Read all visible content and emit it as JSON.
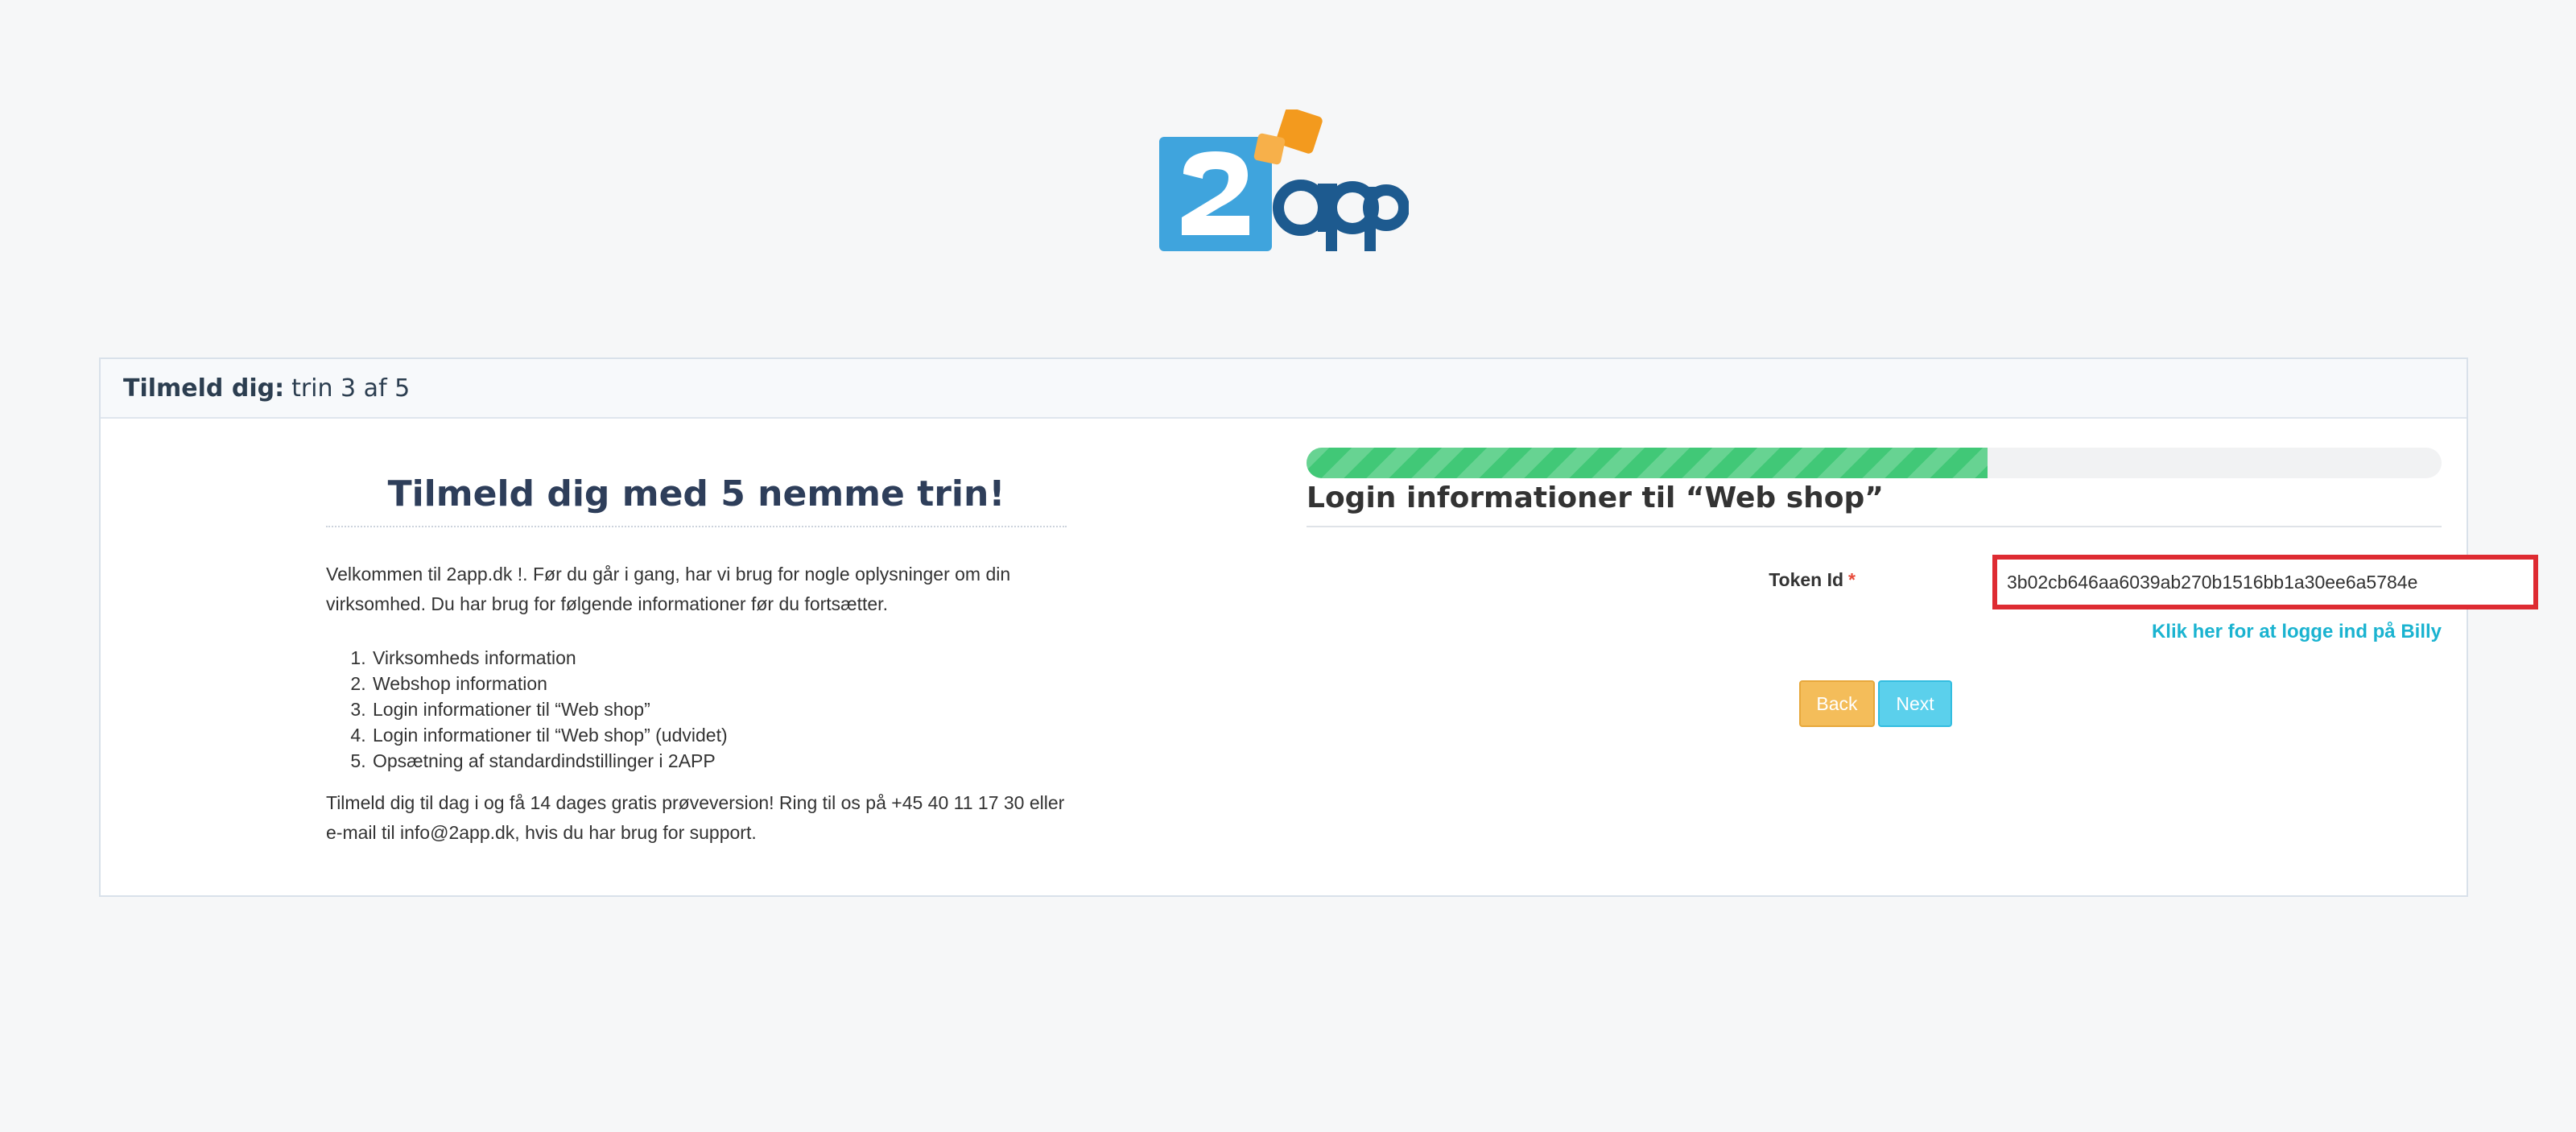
{
  "logo": {
    "text": "2app",
    "colors": {
      "blue": "#3fa4dd",
      "dark": "#1d5a8f",
      "orange": "#f39a1e"
    }
  },
  "panel": {
    "heading_bold": "Tilmeld dig:",
    "heading_rest": "trin 3 af 5"
  },
  "intro": {
    "title": "Tilmeld dig med 5 nemme trin!",
    "text": "Velkommen til 2app.dk !. Før du går i gang, har vi brug for nogle oplysninger om din virksomhed. Du har brug for følgende informationer før du fortsætter.",
    "steps": [
      "Virksomheds information",
      "Webshop information",
      "Login informationer til “Web shop”",
      "Login informationer til “Web shop” (udvidet)",
      "Opsætning af standardindstillinger i 2APP"
    ],
    "outro": "Tilmeld dig til dag i og få 14 dages gratis prøveversion! Ring til os på +45 40 11 17 30 eller e-mail til info@2app.dk, hvis du har brug for support."
  },
  "form": {
    "progress_percent": 60,
    "section_title": "Login informationer til “Web shop”",
    "token_label": "Token Id",
    "required_mark": "*",
    "token_value": "3b02cb646aa6039ab270b1516bb1a30ee6a5784e",
    "billy_link": "Klik her for at logge ind på Billy",
    "back_label": "Back",
    "next_label": "Next"
  }
}
